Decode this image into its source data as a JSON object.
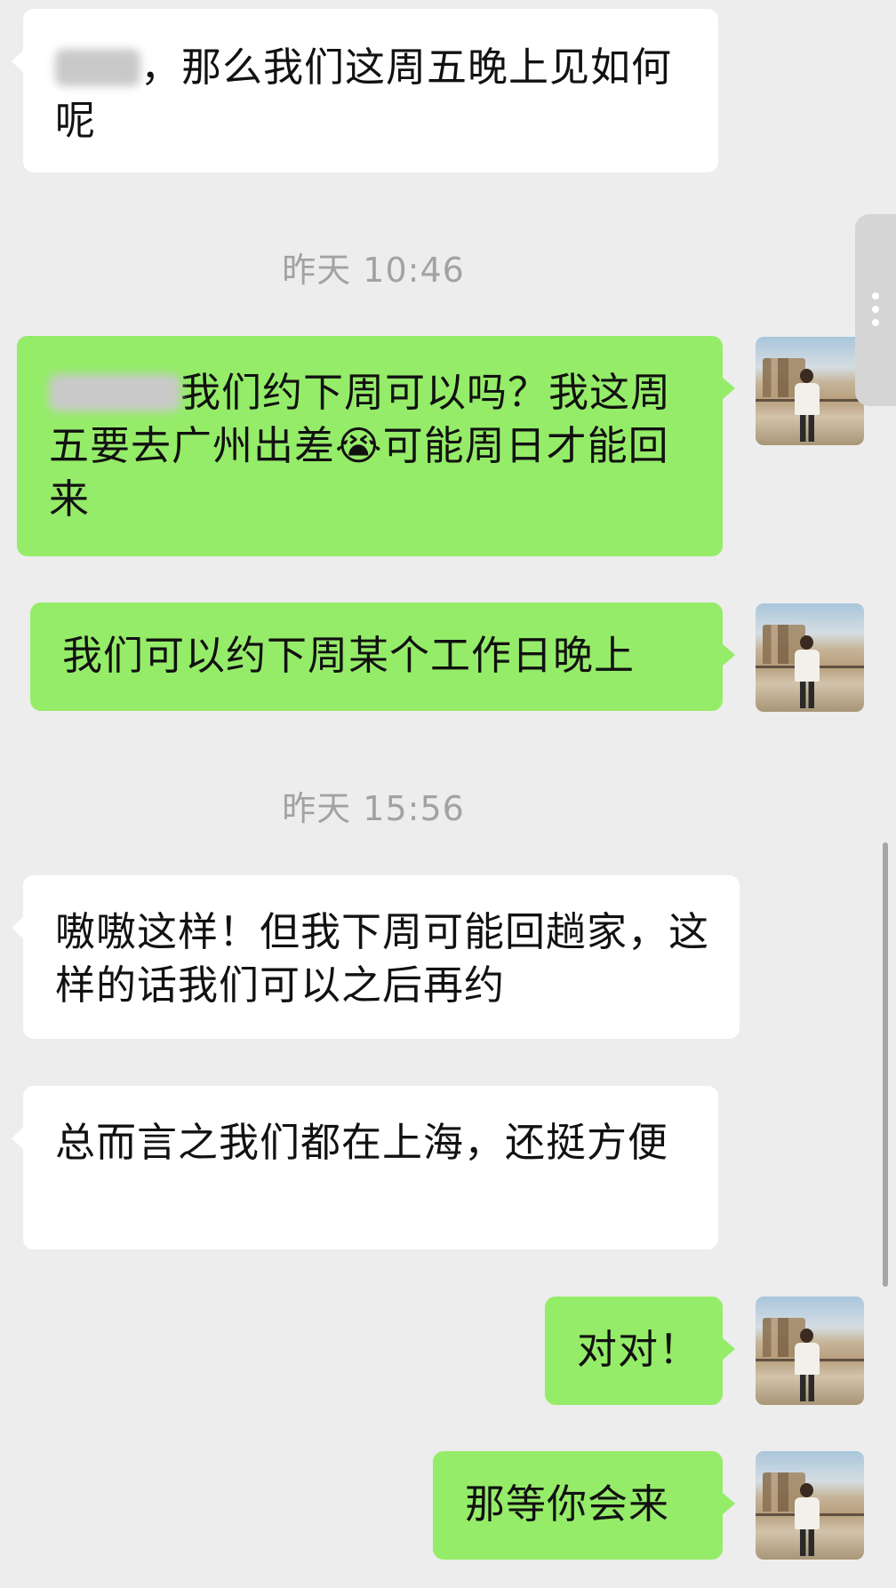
{
  "timestamps": {
    "t1": "昨天 10:46",
    "t2": "昨天 15:56"
  },
  "messages": {
    "m1": "，那么我们这周五晚上见如何呢",
    "m2_text": "我们约下周可以吗？我这周五要去广州出差",
    "m2_emoji": "😭",
    "m2_tail": "可能周日才能回来",
    "m3": "我们可以约下周某个工作日晚上",
    "m4": "嗷嗷这样！但我下周可能回趟家，这样的话我们可以之后再约",
    "m5": "总而言之我们都在上海，还挺方便",
    "m6": "对对！",
    "m7": "那等你会来"
  },
  "colors": {
    "background": "#ededed",
    "incoming_bubble": "#ffffff",
    "outgoing_bubble": "#95ec69",
    "timestamp_text": "#a2a2a2"
  },
  "icons": {
    "scroll_handle": "more-dots-icon",
    "emoji": "loudly-crying-face-emoji"
  }
}
